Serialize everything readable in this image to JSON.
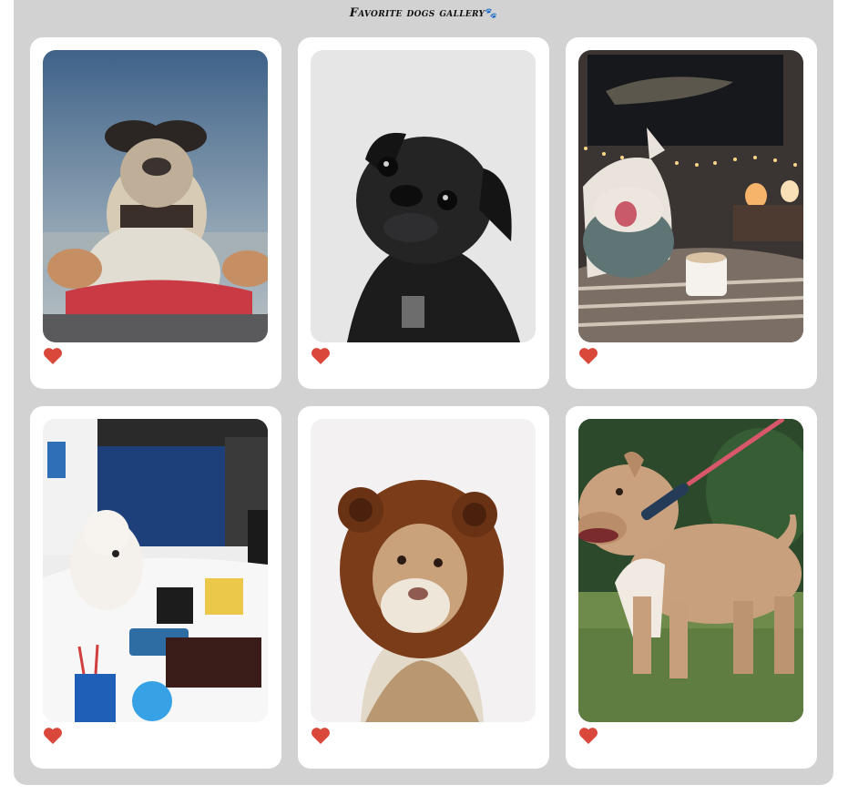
{
  "gallery": {
    "title": "Favorite dogs gallery",
    "title_icon": "paw-icon",
    "title_icon_glyph": "🐾",
    "like_icon": "heart-icon",
    "like_color": "#d9483b",
    "panel_color": "#d2d2d2",
    "cards": [
      {
        "subject": "bulldog-with-sunglasses",
        "liked": true
      },
      {
        "subject": "black-pug",
        "liked": true
      },
      {
        "subject": "dog-with-scarf-and-cocoa",
        "liked": true
      },
      {
        "subject": "samoyed-at-office-desk",
        "liked": true
      },
      {
        "subject": "dog-in-lion-hat",
        "liked": true
      },
      {
        "subject": "pitbull-on-leash",
        "liked": true
      }
    ]
  }
}
